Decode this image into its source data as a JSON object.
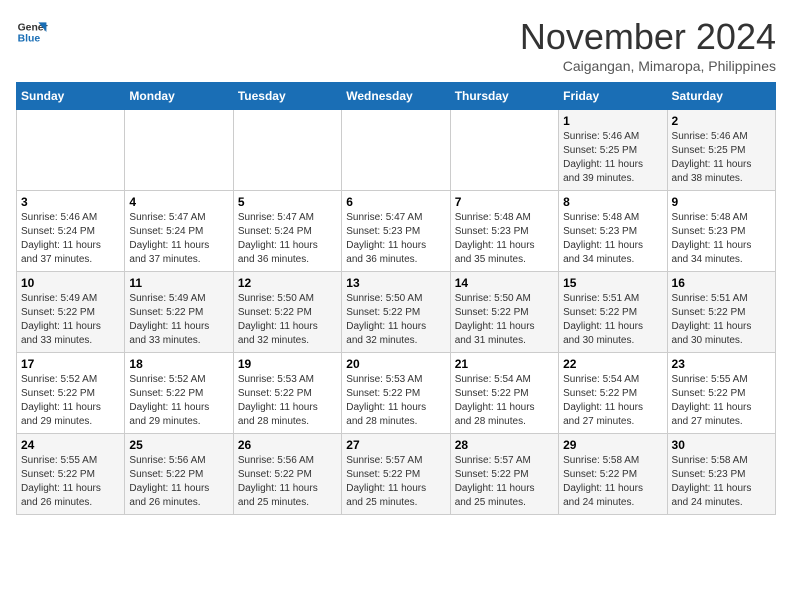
{
  "header": {
    "logo_line1": "General",
    "logo_line2": "Blue",
    "month": "November 2024",
    "location": "Caigangan, Mimaropa, Philippines"
  },
  "days_of_week": [
    "Sunday",
    "Monday",
    "Tuesday",
    "Wednesday",
    "Thursday",
    "Friday",
    "Saturday"
  ],
  "weeks": [
    [
      {
        "day": "",
        "info": ""
      },
      {
        "day": "",
        "info": ""
      },
      {
        "day": "",
        "info": ""
      },
      {
        "day": "",
        "info": ""
      },
      {
        "day": "",
        "info": ""
      },
      {
        "day": "1",
        "info": "Sunrise: 5:46 AM\nSunset: 5:25 PM\nDaylight: 11 hours\nand 39 minutes."
      },
      {
        "day": "2",
        "info": "Sunrise: 5:46 AM\nSunset: 5:25 PM\nDaylight: 11 hours\nand 38 minutes."
      }
    ],
    [
      {
        "day": "3",
        "info": "Sunrise: 5:46 AM\nSunset: 5:24 PM\nDaylight: 11 hours\nand 37 minutes."
      },
      {
        "day": "4",
        "info": "Sunrise: 5:47 AM\nSunset: 5:24 PM\nDaylight: 11 hours\nand 37 minutes."
      },
      {
        "day": "5",
        "info": "Sunrise: 5:47 AM\nSunset: 5:24 PM\nDaylight: 11 hours\nand 36 minutes."
      },
      {
        "day": "6",
        "info": "Sunrise: 5:47 AM\nSunset: 5:23 PM\nDaylight: 11 hours\nand 36 minutes."
      },
      {
        "day": "7",
        "info": "Sunrise: 5:48 AM\nSunset: 5:23 PM\nDaylight: 11 hours\nand 35 minutes."
      },
      {
        "day": "8",
        "info": "Sunrise: 5:48 AM\nSunset: 5:23 PM\nDaylight: 11 hours\nand 34 minutes."
      },
      {
        "day": "9",
        "info": "Sunrise: 5:48 AM\nSunset: 5:23 PM\nDaylight: 11 hours\nand 34 minutes."
      }
    ],
    [
      {
        "day": "10",
        "info": "Sunrise: 5:49 AM\nSunset: 5:22 PM\nDaylight: 11 hours\nand 33 minutes."
      },
      {
        "day": "11",
        "info": "Sunrise: 5:49 AM\nSunset: 5:22 PM\nDaylight: 11 hours\nand 33 minutes."
      },
      {
        "day": "12",
        "info": "Sunrise: 5:50 AM\nSunset: 5:22 PM\nDaylight: 11 hours\nand 32 minutes."
      },
      {
        "day": "13",
        "info": "Sunrise: 5:50 AM\nSunset: 5:22 PM\nDaylight: 11 hours\nand 32 minutes."
      },
      {
        "day": "14",
        "info": "Sunrise: 5:50 AM\nSunset: 5:22 PM\nDaylight: 11 hours\nand 31 minutes."
      },
      {
        "day": "15",
        "info": "Sunrise: 5:51 AM\nSunset: 5:22 PM\nDaylight: 11 hours\nand 30 minutes."
      },
      {
        "day": "16",
        "info": "Sunrise: 5:51 AM\nSunset: 5:22 PM\nDaylight: 11 hours\nand 30 minutes."
      }
    ],
    [
      {
        "day": "17",
        "info": "Sunrise: 5:52 AM\nSunset: 5:22 PM\nDaylight: 11 hours\nand 29 minutes."
      },
      {
        "day": "18",
        "info": "Sunrise: 5:52 AM\nSunset: 5:22 PM\nDaylight: 11 hours\nand 29 minutes."
      },
      {
        "day": "19",
        "info": "Sunrise: 5:53 AM\nSunset: 5:22 PM\nDaylight: 11 hours\nand 28 minutes."
      },
      {
        "day": "20",
        "info": "Sunrise: 5:53 AM\nSunset: 5:22 PM\nDaylight: 11 hours\nand 28 minutes."
      },
      {
        "day": "21",
        "info": "Sunrise: 5:54 AM\nSunset: 5:22 PM\nDaylight: 11 hours\nand 28 minutes."
      },
      {
        "day": "22",
        "info": "Sunrise: 5:54 AM\nSunset: 5:22 PM\nDaylight: 11 hours\nand 27 minutes."
      },
      {
        "day": "23",
        "info": "Sunrise: 5:55 AM\nSunset: 5:22 PM\nDaylight: 11 hours\nand 27 minutes."
      }
    ],
    [
      {
        "day": "24",
        "info": "Sunrise: 5:55 AM\nSunset: 5:22 PM\nDaylight: 11 hours\nand 26 minutes."
      },
      {
        "day": "25",
        "info": "Sunrise: 5:56 AM\nSunset: 5:22 PM\nDaylight: 11 hours\nand 26 minutes."
      },
      {
        "day": "26",
        "info": "Sunrise: 5:56 AM\nSunset: 5:22 PM\nDaylight: 11 hours\nand 25 minutes."
      },
      {
        "day": "27",
        "info": "Sunrise: 5:57 AM\nSunset: 5:22 PM\nDaylight: 11 hours\nand 25 minutes."
      },
      {
        "day": "28",
        "info": "Sunrise: 5:57 AM\nSunset: 5:22 PM\nDaylight: 11 hours\nand 25 minutes."
      },
      {
        "day": "29",
        "info": "Sunrise: 5:58 AM\nSunset: 5:22 PM\nDaylight: 11 hours\nand 24 minutes."
      },
      {
        "day": "30",
        "info": "Sunrise: 5:58 AM\nSunset: 5:23 PM\nDaylight: 11 hours\nand 24 minutes."
      }
    ]
  ]
}
